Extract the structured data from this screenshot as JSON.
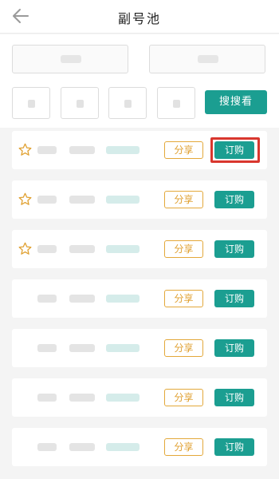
{
  "header": {
    "title": "副号池",
    "back_icon": "arrow-left-icon"
  },
  "search": {
    "button_label": "搜搜看"
  },
  "rows": [
    {
      "starred": true,
      "share_label": "分享",
      "order_label": "订购",
      "highlighted": true
    },
    {
      "starred": true,
      "share_label": "分享",
      "order_label": "订购",
      "highlighted": false
    },
    {
      "starred": true,
      "share_label": "分享",
      "order_label": "订购",
      "highlighted": false
    },
    {
      "starred": false,
      "share_label": "分享",
      "order_label": "订购",
      "highlighted": false
    },
    {
      "starred": false,
      "share_label": "分享",
      "order_label": "订购",
      "highlighted": false
    },
    {
      "starred": false,
      "share_label": "分享",
      "order_label": "订购",
      "highlighted": false
    },
    {
      "starred": false,
      "share_label": "分享",
      "order_label": "订购",
      "highlighted": false
    }
  ],
  "colors": {
    "accent": "#1b9e91",
    "share_border": "#e3a83a",
    "highlight": "#d9372e",
    "star": "#e0a030"
  }
}
